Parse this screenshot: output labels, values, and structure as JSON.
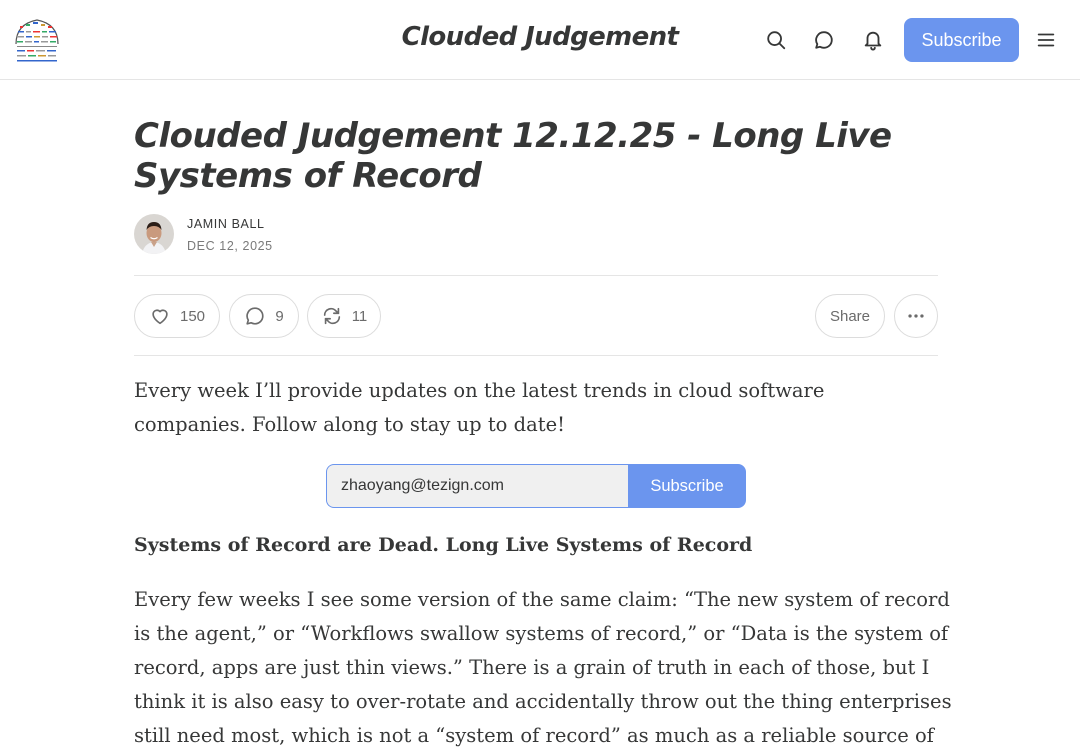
{
  "header": {
    "publication_title": "Clouded Judgement",
    "subscribe_label": "Subscribe",
    "icons": [
      "search-icon",
      "chat-icon",
      "bell-icon",
      "menu-icon"
    ]
  },
  "article": {
    "title": "Clouded Judgement 12.12.25 - Long Live Systems of Record",
    "author": "JAMIN BALL",
    "date": "DEC 12, 2025",
    "actions": {
      "likes": "150",
      "comments": "9",
      "restacks": "11",
      "share_label": "Share"
    },
    "intro": "Every week I’ll provide updates on the latest trends in cloud software companies. Follow along to stay up to date!",
    "subscribe_form": {
      "email_value": "zhaoyang@tezign.com",
      "button_label": "Subscribe"
    },
    "section_heading": "Systems of Record are Dead. Long Live Systems of Record",
    "paragraph": "Every few weeks I see some version of the same claim: “The new system of record is the agent,” or “Workflows swallow systems of record,” or “Data is the system of record, apps are just thin views.” There is a grain of truth in each of those, but I think it is also easy to over-rotate and accidentally throw out the thing enterprises still need most, which is not a “system of record” as much as a reliable source of truth."
  },
  "colors": {
    "accent": "#6b95ee",
    "text": "#363737",
    "muted": "#7a7a7a",
    "border": "#e5e5e5"
  }
}
